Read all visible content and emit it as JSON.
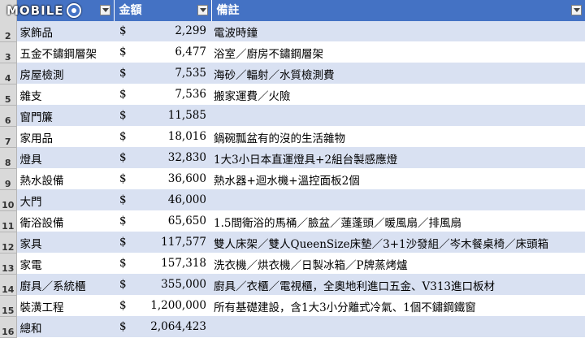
{
  "logo": {
    "text": "MOBILE"
  },
  "header": {
    "item": "",
    "amount": "金額",
    "note": "備註"
  },
  "currency": "$",
  "rows": [
    {
      "num": "2",
      "item": "家飾品",
      "amount": "2,299",
      "note": "電波時鐘"
    },
    {
      "num": "3",
      "item": "五金不鏽鋼層架",
      "amount": "6,477",
      "note": "浴室／廚房不鏽鋼層架"
    },
    {
      "num": "4",
      "item": "房屋檢測",
      "amount": "7,535",
      "note": "海砂／輻射／水質檢測費"
    },
    {
      "num": "5",
      "item": "雜支",
      "amount": "7,536",
      "note": "搬家運費／火險"
    },
    {
      "num": "6",
      "item": "窗門簾",
      "amount": "11,585",
      "note": ""
    },
    {
      "num": "7",
      "item": "家用品",
      "amount": "18,016",
      "note": "鍋碗瓢盆有的沒的生活雜物"
    },
    {
      "num": "8",
      "item": "燈具",
      "amount": "32,830",
      "note": "1大3小日本直運燈具+2組台製感應燈"
    },
    {
      "num": "9",
      "item": "熱水設備",
      "amount": "36,600",
      "note": "熱水器+迴水機+溫控面板2個"
    },
    {
      "num": "10",
      "item": "大門",
      "amount": "46,000",
      "note": ""
    },
    {
      "num": "11",
      "item": "衛浴設備",
      "amount": "65,650",
      "note": "1.5間衛浴的馬桶／臉盆／蓮蓬頭／暖風扇／排風扇"
    },
    {
      "num": "12",
      "item": "家具",
      "amount": "117,577",
      "note": "雙人床架／雙人QueenSize床墊／3+1沙發組／岑木餐桌椅／床頭箱"
    },
    {
      "num": "13",
      "item": "家電",
      "amount": "157,318",
      "note": "洗衣機／烘衣機／日製冰箱／P牌蒸烤爐"
    },
    {
      "num": "14",
      "item": "廚具／系統櫃",
      "amount": "355,000",
      "note": "廚具／衣櫃／電視櫃，全奧地利進口五金、V313進口板材"
    },
    {
      "num": "15",
      "item": "裝潢工程",
      "amount": "1,200,000",
      "note": "所有基礎建設，含1大3小分離式冷氣、1個不鏽鋼鐵窗"
    },
    {
      "num": "16",
      "item": "總和",
      "amount": "2,064,423",
      "note": ""
    }
  ],
  "colors": {
    "header_bg": "#4472c4",
    "band": "#d9e1f2",
    "row_header": "#d9d9d9"
  }
}
